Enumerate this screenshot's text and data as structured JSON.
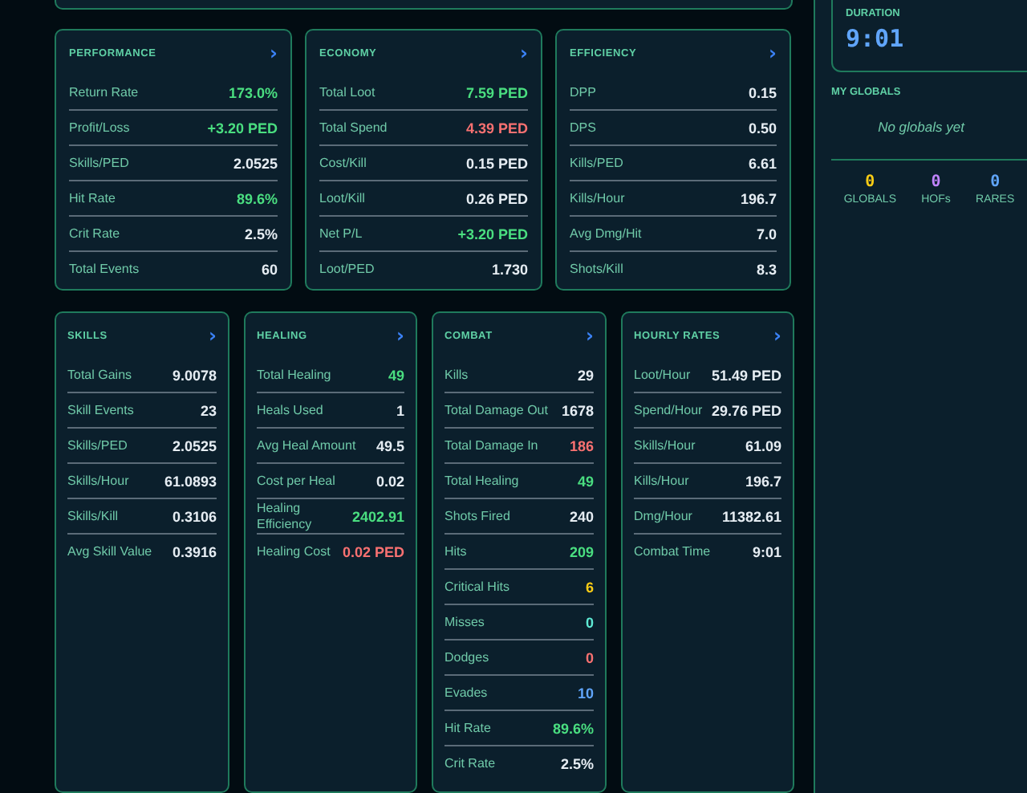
{
  "top_row": [
    {
      "title": "PERFORMANCE",
      "chevron": "›",
      "rows": [
        {
          "label": "Return Rate",
          "value": "173.0%",
          "color": "#4ade80"
        },
        {
          "label": "Profit/Loss",
          "value": "+3.20 PED",
          "color": "#4ade80"
        },
        {
          "label": "Skills/PED",
          "value": "2.0525",
          "color": "#e6edf3"
        },
        {
          "label": "Hit Rate",
          "value": "89.6%",
          "color": "#4ade80"
        },
        {
          "label": "Crit Rate",
          "value": "2.5%",
          "color": "#e6edf3"
        },
        {
          "label": "Total Events",
          "value": "60",
          "color": "#e6edf3"
        }
      ]
    },
    {
      "title": "ECONOMY",
      "chevron": "›",
      "rows": [
        {
          "label": "Total Loot",
          "value": "7.59 PED",
          "color": "#4ade80"
        },
        {
          "label": "Total Spend",
          "value": "4.39 PED",
          "color": "#f87171"
        },
        {
          "label": "Cost/Kill",
          "value": "0.15 PED",
          "color": "#e6edf3"
        },
        {
          "label": "Loot/Kill",
          "value": "0.26 PED",
          "color": "#e6edf3"
        },
        {
          "label": "Net P/L",
          "value": "+3.20 PED",
          "color": "#4ade80"
        },
        {
          "label": "Loot/PED",
          "value": "1.730",
          "color": "#e6edf3"
        }
      ]
    },
    {
      "title": "EFFICIENCY",
      "chevron": "›",
      "rows": [
        {
          "label": "DPP",
          "value": "0.15",
          "color": "#e6edf3"
        },
        {
          "label": "DPS",
          "value": "0.50",
          "color": "#e6edf3"
        },
        {
          "label": "Kills/PED",
          "value": "6.61",
          "color": "#e6edf3"
        },
        {
          "label": "Kills/Hour",
          "value": "196.7",
          "color": "#e6edf3"
        },
        {
          "label": "Avg Dmg/Hit",
          "value": "7.0",
          "color": "#e6edf3"
        },
        {
          "label": "Shots/Kill",
          "value": "8.3",
          "color": "#e6edf3"
        }
      ]
    }
  ],
  "bottom_row": [
    {
      "title": "SKILLS",
      "chevron": "›",
      "rows": [
        {
          "label": "Total Gains",
          "value": "9.0078",
          "color": "#e6edf3"
        },
        {
          "label": "Skill Events",
          "value": "23",
          "color": "#e6edf3"
        },
        {
          "label": "Skills/PED",
          "value": "2.0525",
          "color": "#e6edf3"
        },
        {
          "label": "Skills/Hour",
          "value": "61.0893",
          "color": "#e6edf3"
        },
        {
          "label": "Skills/Kill",
          "value": "0.3106",
          "color": "#e6edf3"
        },
        {
          "label": "Avg Skill Value",
          "value": "0.3916",
          "color": "#e6edf3"
        }
      ]
    },
    {
      "title": "HEALING",
      "chevron": "›",
      "rows": [
        {
          "label": "Total Healing",
          "value": "49",
          "color": "#4ade80"
        },
        {
          "label": "Heals Used",
          "value": "1",
          "color": "#e6edf3"
        },
        {
          "label": "Avg Heal Amount",
          "value": "49.5",
          "color": "#e6edf3"
        },
        {
          "label": "Cost per Heal",
          "value": "0.02",
          "color": "#e6edf3"
        },
        {
          "label": "Healing Efficiency",
          "value": "2402.91",
          "color": "#4ade80"
        },
        {
          "label": "Healing Cost",
          "value": "0.02 PED",
          "color": "#f87171"
        }
      ]
    },
    {
      "title": "COMBAT",
      "chevron": "›",
      "rows": [
        {
          "label": "Kills",
          "value": "29",
          "color": "#e6edf3"
        },
        {
          "label": "Total Damage Out",
          "value": "1678",
          "color": "#e6edf3"
        },
        {
          "label": "Total Damage In",
          "value": "186",
          "color": "#f87171"
        },
        {
          "label": "Total Healing",
          "value": "49",
          "color": "#4ade80"
        },
        {
          "label": "Shots Fired",
          "value": "240",
          "color": "#e6edf3"
        },
        {
          "label": "Hits",
          "value": "209",
          "color": "#4ade80"
        },
        {
          "label": "Critical Hits",
          "value": "6",
          "color": "#facc15"
        },
        {
          "label": "Misses",
          "value": "0",
          "color": "#5eead4"
        },
        {
          "label": "Dodges",
          "value": "0",
          "color": "#f87171"
        },
        {
          "label": "Evades",
          "value": "10",
          "color": "#60a5fa"
        },
        {
          "label": "Hit Rate",
          "value": "89.6%",
          "color": "#4ade80"
        },
        {
          "label": "Crit Rate",
          "value": "2.5%",
          "color": "#e6edf3"
        }
      ]
    },
    {
      "title": "HOURLY RATES",
      "chevron": "›",
      "rows": [
        {
          "label": "Loot/Hour",
          "value": "51.49 PED",
          "color": "#e6edf3"
        },
        {
          "label": "Spend/Hour",
          "value": "29.76 PED",
          "color": "#e6edf3"
        },
        {
          "label": "Skills/Hour",
          "value": "61.09",
          "color": "#e6edf3"
        },
        {
          "label": "Kills/Hour",
          "value": "196.7",
          "color": "#e6edf3"
        },
        {
          "label": "Dmg/Hour",
          "value": "11382.61",
          "color": "#e6edf3"
        },
        {
          "label": "Combat Time",
          "value": "9:01",
          "color": "#e6edf3"
        }
      ]
    }
  ],
  "sidebar": {
    "duration": {
      "label": "DURATION",
      "value": "9:01"
    },
    "globals": {
      "title": "MY GLOBALS",
      "empty_text": "No globals yet"
    },
    "counters": [
      {
        "value": "0",
        "label": "GLOBALS",
        "color": "#facc15"
      },
      {
        "value": "0",
        "label": "HOFs",
        "color": "#c084fc"
      },
      {
        "value": "0",
        "label": "RARES",
        "color": "#60a5fa"
      }
    ]
  }
}
